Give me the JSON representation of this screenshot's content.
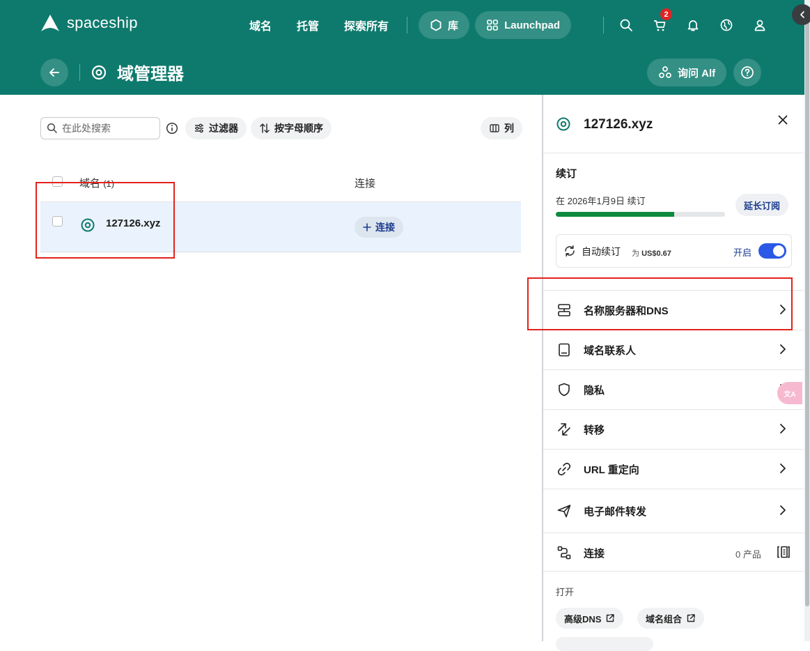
{
  "app": {
    "logo_text": "spaceship"
  },
  "nav": {
    "links": [
      "域名",
      "托管",
      "探索所有"
    ],
    "library_label": "库",
    "launchpad_label": "Launchpad",
    "cart_count": "2"
  },
  "subheader": {
    "title": "域管理器",
    "ask_alf_label": "询问 Alf"
  },
  "toolbar": {
    "search_placeholder": "在此处搜索",
    "filter_label": "过滤器",
    "sort_label": "按字母顺序",
    "columns_label": "列"
  },
  "table": {
    "header_domain": "域名",
    "header_domain_count": "(1)",
    "header_connect": "连接",
    "rows": [
      {
        "domain": "127126.xyz",
        "connect_label": "连接"
      }
    ]
  },
  "panel": {
    "domain": "127126.xyz",
    "renewal_title": "续订",
    "renewal_date": "在 2026年1月9日 续订",
    "renewal_progress": 0.7,
    "extend_label": "延长订阅",
    "auto_renew_label": "自动续订",
    "auto_renew_price_prefix": "为",
    "auto_renew_price": "US$0.67",
    "auto_renew_state": "开启",
    "menu": [
      {
        "label": "名称服务器和DNS",
        "icon": "server-icon"
      },
      {
        "label": "域名联系人",
        "icon": "contact-book-icon"
      },
      {
        "label": "隐私",
        "icon": "shield-icon"
      },
      {
        "label": "转移",
        "icon": "transfer-icon"
      },
      {
        "label": "URL 重定向",
        "icon": "link-icon"
      },
      {
        "label": "电子邮件转发",
        "icon": "mail-forward-icon"
      },
      {
        "label": "连接",
        "icon": "connect-icon"
      }
    ],
    "connect_count": "0 产品",
    "open_label": "打开",
    "open_links": [
      "高级DNS",
      "域名组合"
    ]
  },
  "colors": {
    "brand": "#0e7a6d",
    "accent_blue": "#2b59e6",
    "highlight_red": "#e3211b",
    "progress_green": "#0e8a3e"
  }
}
